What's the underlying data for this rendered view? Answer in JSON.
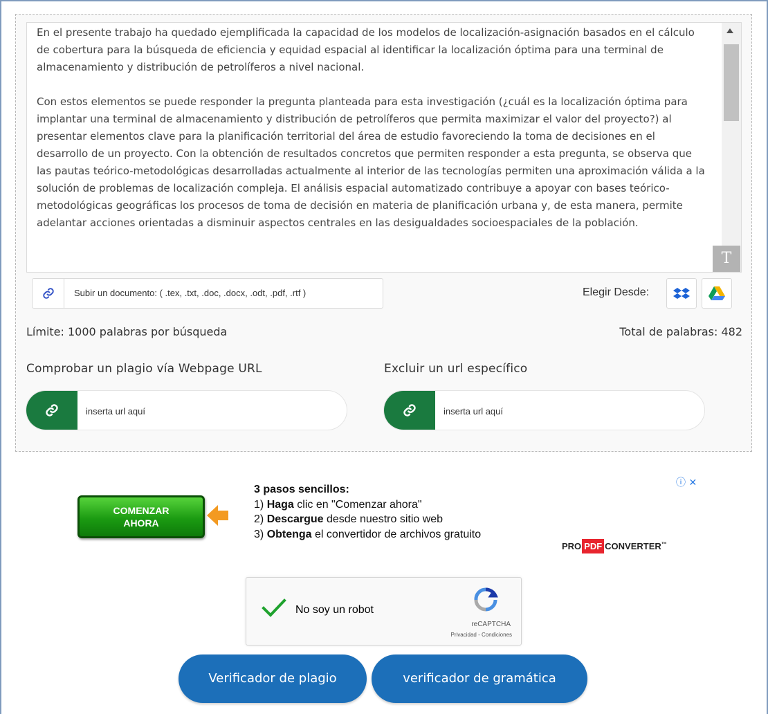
{
  "editor": {
    "paragraphs": [
      "En el presente trabajo ha quedado ejemplificada la capacidad de los modelos de localización-asignación basados en el cálculo de cobertura para la búsqueda de eficiencia y equidad espacial al identificar la localización óptima para una terminal de almacenamiento y distribución de petrolíferos a nivel nacional.",
      "Con estos elementos se puede responder la pregunta planteada para esta investigación (¿cuál es la localización óptima para implantar una terminal de almacenamiento y distribución de petrolíferos que permita maximizar el valor del proyecto?) al presentar elementos clave para la planificación territorial del área de estudio favoreciendo la toma de decisiones en el desarrollo de un proyecto. Con la obtención de resultados concretos que permiten responder a esta pregunta, se observa que las pautas teórico-metodológicas desarrolladas actualmente al interior de las tecnologías permiten una aproximación válida a la solución de problemas de localización compleja. El análisis espacial automatizado contribuye a apoyar con bases teórico-metodológicas geográficas los procesos de toma de decisión en materia de planificación urbana y, de esta manera, permite adelantar acciones orientadas a disminuir aspectos centrales en las desigualdades socioespaciales de la población."
    ],
    "resize_glyph": "T"
  },
  "upload": {
    "label": "Subir un documento: ( .tex, .txt, .doc, .docx, .odt, .pdf, .rtf )",
    "choose_from": "Elegir Desde:",
    "dropbox_icon": "dropbox-icon",
    "gdrive_icon": "google-drive-icon"
  },
  "limits": {
    "limit_text": "Límite: 1000 palabras por búsqueda",
    "total_text": "Total de palabras: 482"
  },
  "url_check": {
    "check_title": "Comprobar un plagio vía Webpage URL",
    "check_placeholder": "inserta url aquí",
    "exclude_title": "Excluir un url específico",
    "exclude_placeholder": "inserta url aquí"
  },
  "ad": {
    "button_label_1": "COMENZAR",
    "button_label_2": "AHORA",
    "steps_title": "3 pasos sencillos:",
    "step1_num": "1)",
    "step1_bold": "Haga",
    "step1_rest": " clic en \"Comenzar ahora\"",
    "step2_num": "2)",
    "step2_bold": "Descargue",
    "step2_rest": " desde nuestro sitio web",
    "step3_num": "3)",
    "step3_bold": "Obtenga",
    "step3_rest": " el convertidor de archivos gratuito",
    "logo_pre": "PRO",
    "logo_pdf": "PDF",
    "logo_post": "CONVERTER",
    "logo_tm": "™",
    "close_glyphs": "ⓘ ✕"
  },
  "captcha": {
    "label": "No soy un robot",
    "brand": "reCAPTCHA",
    "terms": "Privacidad - Condiciones",
    "accent": "#1fa22e"
  },
  "actions": {
    "plagiarism_label": "Verificador de plagio",
    "grammar_label": "verificador de gramática",
    "color": "#1c6fb9"
  }
}
